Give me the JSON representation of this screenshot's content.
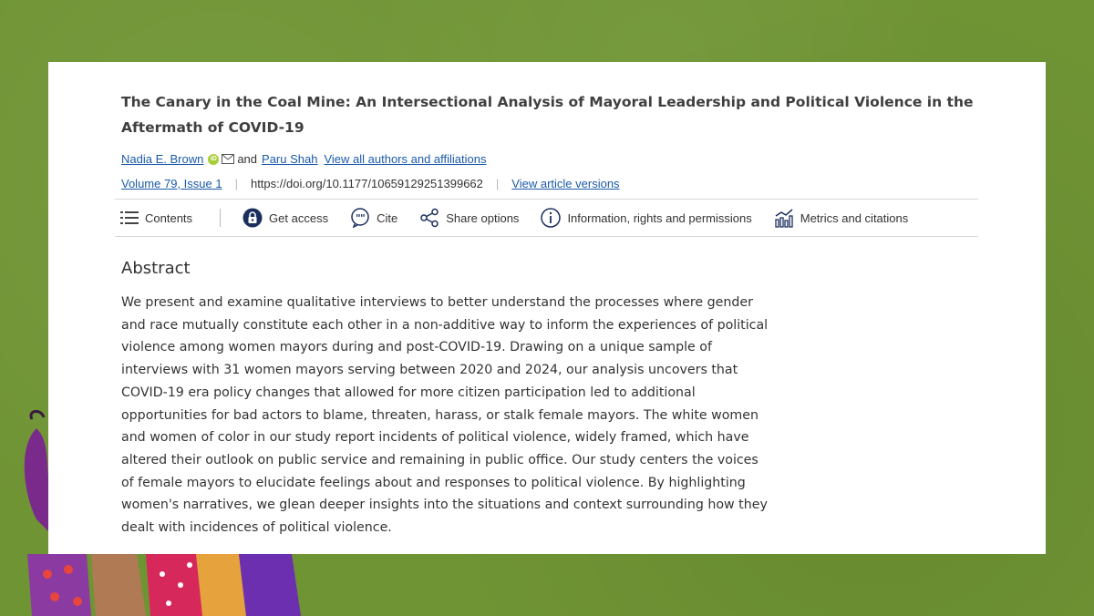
{
  "article": {
    "title": "The Canary in the Coal Mine: An Intersectional Analysis of Mayoral Leadership and Political Violence in the Aftermath of COVID-19",
    "authors": {
      "first": "Nadia E. Brown",
      "joiner": "and",
      "second": "Paru Shah",
      "view_all": "View all authors and affiliations"
    },
    "meta": {
      "volume": "Volume 79, Issue 1",
      "doi": "https://doi.org/10.1177/10659129251399662",
      "versions": "View article versions"
    }
  },
  "toolbar": {
    "contents": "Contents",
    "get_access": "Get access",
    "cite": "Cite",
    "share": "Share options",
    "info": "Information, rights and permissions",
    "metrics": "Metrics and citations"
  },
  "abstract": {
    "heading": "Abstract",
    "text": "We present and examine qualitative interviews to better understand the processes where gender and race mutually constitute each other in a non-additive way to inform the experiences of political violence among women mayors during and post-COVID-19. Drawing on a unique sample of interviews with 31 women mayors serving between 2020 and 2024, our analysis uncovers that COVID-19 era policy changes that allowed for more citizen participation led to additional opportunities for bad actors to blame, threaten, harass, or stalk female mayors. The white women and women of color in our study report incidents of political violence, widely framed, which have altered their outlook on public service and remaining in public office. Our study centers the voices of female mayors to elucidate feelings about and responses to political violence. By highlighting women's narratives, we glean deeper insights into the situations and context surrounding how they dealt with incidences of political violence."
  },
  "colors": {
    "background": "#6f9434",
    "link": "#1a5aa8",
    "access_icon": "#1b2f5e",
    "orcid": "#a6ce39"
  }
}
